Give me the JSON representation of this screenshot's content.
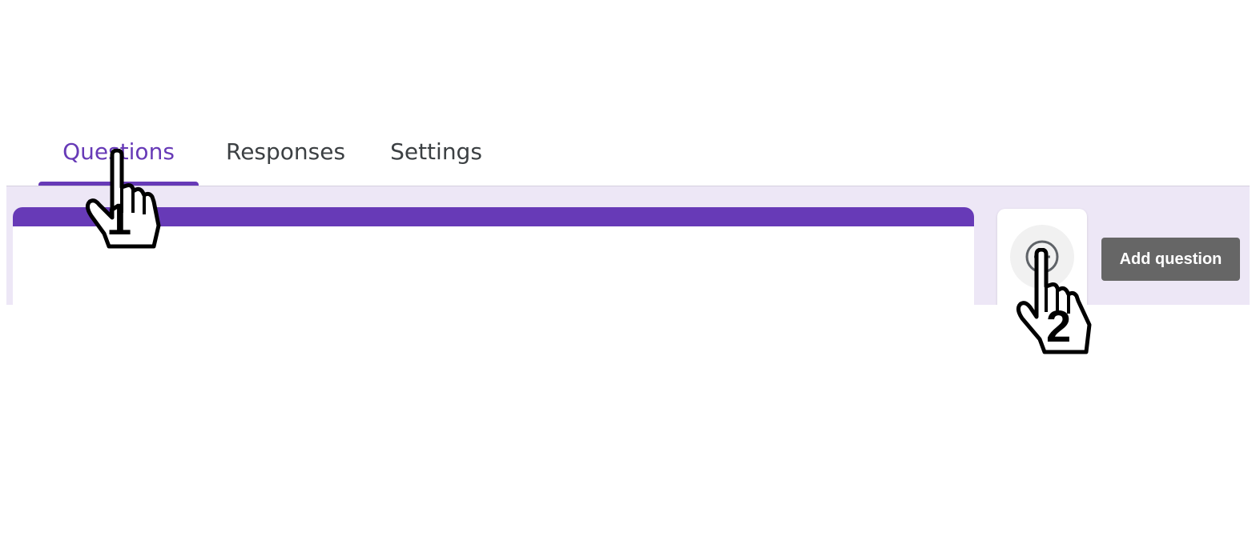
{
  "tabs": [
    {
      "label": "Questions",
      "active": true
    },
    {
      "label": "Responses",
      "active": false
    },
    {
      "label": "Settings",
      "active": false
    }
  ],
  "toolbar": {
    "add_button_icon": "add-circle-icon",
    "tooltip": "Add question"
  },
  "annotations": {
    "step_1": "1",
    "step_2": "2"
  },
  "colors": {
    "accent": "#673ab7",
    "background_tint": "#ede7f6",
    "tooltip_bg": "#666666"
  }
}
